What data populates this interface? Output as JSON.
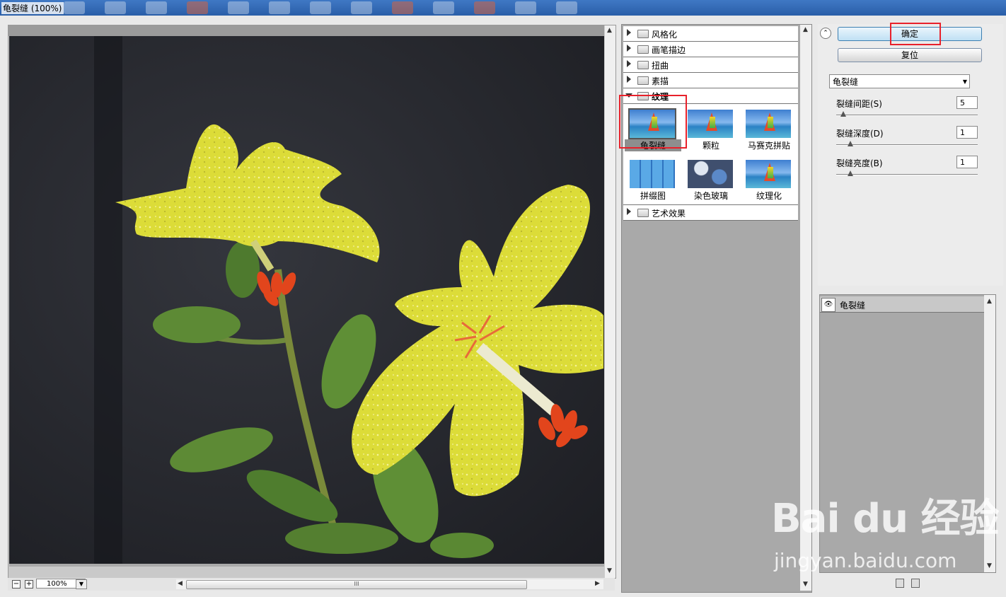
{
  "window": {
    "title": "龟裂缝 (100%)"
  },
  "preview": {
    "zoom": "100%",
    "zoom_out": "−",
    "zoom_in": "+",
    "hscroll_grip": "III"
  },
  "filter_gallery": {
    "categories_top": [
      {
        "label": "风格化",
        "expanded": false
      },
      {
        "label": "画笔描边",
        "expanded": false
      },
      {
        "label": "扭曲",
        "expanded": false
      },
      {
        "label": "素描",
        "expanded": false
      },
      {
        "label": "纹理",
        "expanded": true
      }
    ],
    "texture_filters": [
      {
        "label": "龟裂缝",
        "selected": true
      },
      {
        "label": "颗粒",
        "selected": false
      },
      {
        "label": "马赛克拼贴",
        "selected": false
      },
      {
        "label": "拼缀图",
        "selected": false
      },
      {
        "label": "染色玻璃",
        "selected": false
      },
      {
        "label": "纹理化",
        "selected": false
      }
    ],
    "categories_bottom": [
      {
        "label": "艺术效果",
        "expanded": false
      }
    ]
  },
  "controls": {
    "ok_label": "确定",
    "reset_label": "复位",
    "filter_select": "龟裂缝",
    "params": [
      {
        "label": "裂缝间距(S)",
        "value": "5",
        "fraction": 0.05
      },
      {
        "label": "裂缝深度(D)",
        "value": "1",
        "fraction": 0.1
      },
      {
        "label": "裂缝亮度(B)",
        "value": "1",
        "fraction": 0.1
      }
    ]
  },
  "layers": [
    {
      "label": "龟裂缝"
    }
  ],
  "watermark": {
    "brand": "Bai du 经验",
    "url": "jingyan.baidu.com"
  },
  "colors": {
    "highlight": "#e8212b",
    "flower": "#dcdc38",
    "stamen": "#e2451c"
  }
}
